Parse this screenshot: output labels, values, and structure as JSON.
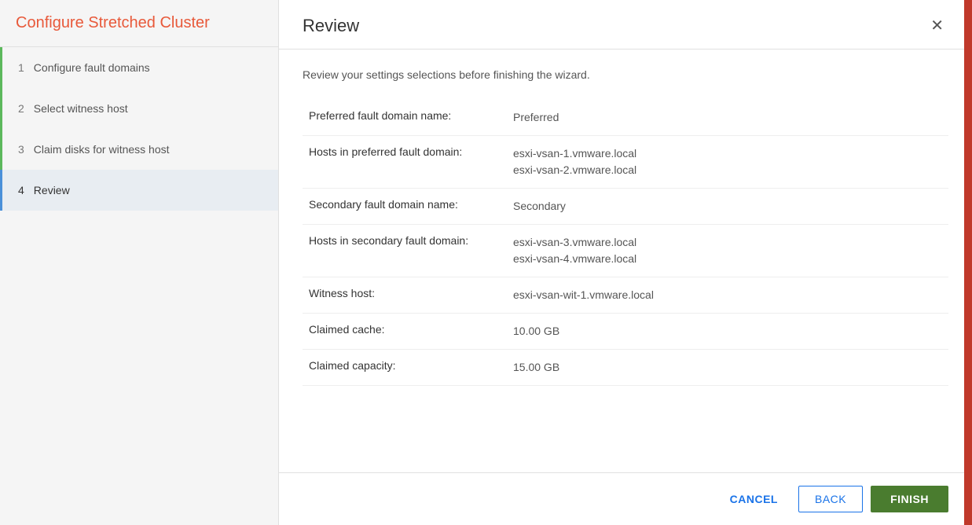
{
  "sidebar": {
    "title": "Configure Stretched Cluster",
    "steps": [
      {
        "number": "1",
        "label": "Configure fault domains",
        "state": "completed"
      },
      {
        "number": "2",
        "label": "Select witness host",
        "state": "completed"
      },
      {
        "number": "3",
        "label": "Claim disks for witness host",
        "state": "completed"
      },
      {
        "number": "4",
        "label": "Review",
        "state": "active"
      }
    ]
  },
  "main": {
    "title": "Review",
    "subtitle": "Review your settings selections before finishing the wizard.",
    "rows": [
      {
        "label": "Preferred fault domain name:",
        "values": [
          "Preferred"
        ]
      },
      {
        "label": "Hosts in preferred fault domain:",
        "values": [
          "esxi-vsan-1.vmware.local",
          "esxi-vsan-2.vmware.local"
        ]
      },
      {
        "label": "Secondary fault domain name:",
        "values": [
          "Secondary"
        ]
      },
      {
        "label": "Hosts in secondary fault domain:",
        "values": [
          "esxi-vsan-3.vmware.local",
          "esxi-vsan-4.vmware.local"
        ]
      },
      {
        "label": "Witness host:",
        "values": [
          "esxi-vsan-wit-1.vmware.local"
        ]
      },
      {
        "label": "Claimed cache:",
        "values": [
          "10.00 GB"
        ]
      },
      {
        "label": "Claimed capacity:",
        "values": [
          "15.00 GB"
        ]
      }
    ]
  },
  "footer": {
    "cancel_label": "CANCEL",
    "back_label": "BACK",
    "finish_label": "FINISH"
  }
}
